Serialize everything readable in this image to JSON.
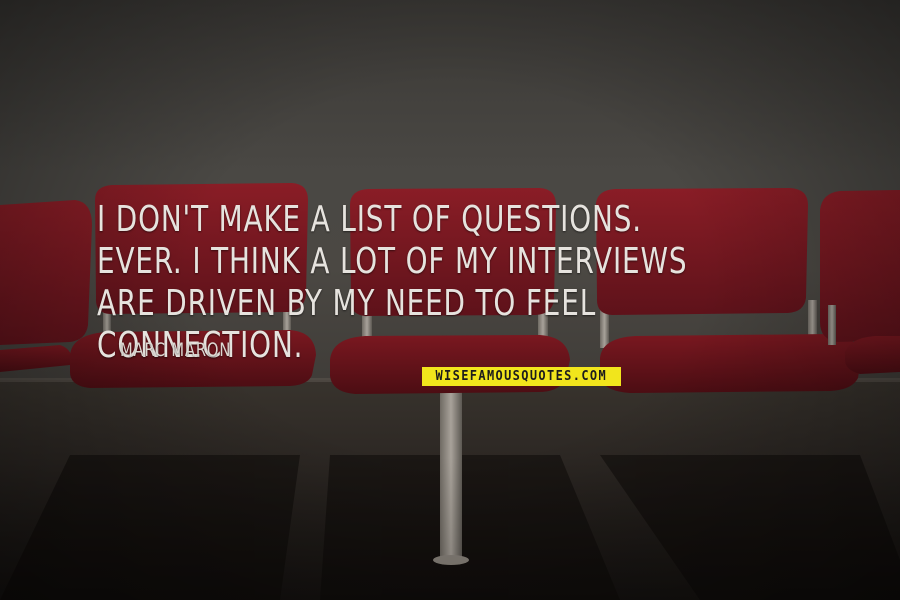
{
  "quote": {
    "text": "I don't make a list of questions. Ever. I think a lot of my interviews are driven by my need to feel connection.",
    "author": "Marc Maron"
  },
  "watermark": {
    "text": "WISEFAMOUSQUOTES.COM",
    "background": "#f1e51c"
  },
  "colors": {
    "seat": "#7d1a22",
    "wall": "#4a4844",
    "text": "#e6e3de"
  }
}
